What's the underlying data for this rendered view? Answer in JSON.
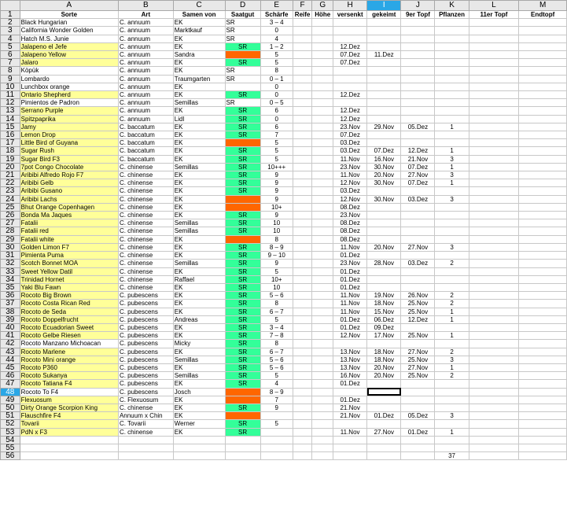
{
  "columns": [
    "A",
    "B",
    "C",
    "D",
    "E",
    "F",
    "G",
    "H",
    "I",
    "J",
    "K",
    "L",
    "M"
  ],
  "selected_column": "I",
  "selected_row": 48,
  "header_row": [
    "Sorte",
    "Art",
    "Samen von",
    "Saatgut",
    "Schärfe",
    "Reife",
    "Höhe",
    "versenkt",
    "gekeimt",
    "9er Topf",
    "Pflanzen",
    "11er Topf",
    "Endtopf"
  ],
  "rows": [
    {
      "n": 2,
      "a": "Black Hungarian",
      "b": "C. annuum",
      "c": "EK",
      "d": "SR",
      "e": "3 – 4"
    },
    {
      "n": 3,
      "a": "California Wonder Golden",
      "b": "C. annuum",
      "c": "Marktkauf",
      "d": "SR",
      "e": "0"
    },
    {
      "n": 4,
      "a": "Hatch M.S. Junie",
      "b": "C. annuum",
      "c": "EK",
      "d": "SR",
      "e": "4"
    },
    {
      "n": 5,
      "a": "Jalapeno el Jefe",
      "ay": true,
      "b": "C. annuum",
      "c": "EK",
      "d": "SR",
      "dc": "green",
      "e": "1 – 2",
      "h": "12.Dez"
    },
    {
      "n": 6,
      "a": "Jalapeno Yellow",
      "ay": true,
      "b": "C. annuum",
      "c": "Sandra",
      "dc": "orange",
      "e": "5",
      "h": "07.Dez",
      "i": "11.Dez"
    },
    {
      "n": 7,
      "a": "Jalaro",
      "ay": true,
      "b": "C. annuum",
      "c": "EK",
      "d": "SR",
      "dc": "green",
      "e": "5",
      "h": "07.Dez"
    },
    {
      "n": 8,
      "a": "Köpük",
      "b": "C. annuum",
      "c": "EK",
      "d": "SR",
      "e": "8"
    },
    {
      "n": 9,
      "a": "Lombardo",
      "b": "C. annuum",
      "c": "Traumgarten",
      "d": "SR",
      "e": "0 – 1"
    },
    {
      "n": 10,
      "a": "Lunchbox orange",
      "b": "C. annuum",
      "c": "EK",
      "e": "0"
    },
    {
      "n": 11,
      "a": "Ontario Shepherd",
      "ay": true,
      "b": "C. annuum",
      "c": "EK",
      "d": "SR",
      "dc": "green",
      "e": "0",
      "h": "12.Dez"
    },
    {
      "n": 12,
      "a": "Pimientos de Padron",
      "b": "C. annuum",
      "c": "Semillas",
      "d": "SR",
      "e": "0 – 5"
    },
    {
      "n": 13,
      "a": "Serrano Purple",
      "ay": true,
      "b": "C. annuum",
      "c": "EK",
      "d": "SR",
      "dc": "green",
      "e": "6",
      "h": "12.Dez"
    },
    {
      "n": 14,
      "a": "Spitzpaprika",
      "ay": true,
      "b": "C. annuum",
      "c": "Lidl",
      "d": "SR",
      "dc": "green",
      "e": "0",
      "h": "12.Dez"
    },
    {
      "n": 15,
      "a": "Jamy",
      "ay": true,
      "b": "C. baccatum",
      "c": "EK",
      "d": "SR",
      "dc": "green",
      "e": "6",
      "h": "23.Nov",
      "i": "29.Nov",
      "j": "05.Dez",
      "k": "1"
    },
    {
      "n": 16,
      "a": "Lemon Drop",
      "ay": true,
      "b": "C. baccatum",
      "c": "EK",
      "d": "SR",
      "dc": "green",
      "e": "7",
      "h": "07.Dez"
    },
    {
      "n": 17,
      "a": "Little Bird of Guyana",
      "ay": true,
      "b": "C. baccatum",
      "c": "EK",
      "dc": "orange",
      "e": "5",
      "h": "03.Dez"
    },
    {
      "n": 18,
      "a": "Sugar Rush",
      "ay": true,
      "b": "C. baccatum",
      "c": "EK",
      "d": "SR",
      "dc": "green",
      "e": "5",
      "h": "03.Dez",
      "i": "07.Dez",
      "j": "12.Dez",
      "k": "1"
    },
    {
      "n": 19,
      "a": "Sugar Bird F3",
      "ay": true,
      "b": "C. baccatum",
      "c": "EK",
      "d": "SR",
      "dc": "green",
      "e": "5",
      "h": "11.Nov",
      "i": "16.Nov",
      "j": "21.Nov",
      "k": "3"
    },
    {
      "n": 20,
      "a": "7pot Congo Chocolate",
      "ay": true,
      "b": "C. chinense",
      "c": "Semillas",
      "d": "SR",
      "dc": "green",
      "e": "10+++",
      "h": "23.Nov",
      "i": "30.Nov",
      "j": "07.Dez",
      "k": "1"
    },
    {
      "n": 21,
      "a": "Aribibi Alfredo Rojo F7",
      "ay": true,
      "b": "C. chinense",
      "c": "EK",
      "d": "SR",
      "dc": "green",
      "e": "9",
      "h": "11.Nov",
      "i": "20.Nov",
      "j": "27.Nov",
      "k": "3"
    },
    {
      "n": 22,
      "a": "Aribibi Gelb",
      "ay": true,
      "b": "C. chinense",
      "c": "EK",
      "d": "SR",
      "dc": "green",
      "e": "9",
      "h": "12.Nov",
      "i": "30.Nov",
      "j": "07.Dez",
      "k": "1"
    },
    {
      "n": 23,
      "a": "Aribibi Gusano",
      "ay": true,
      "b": "C. chinense",
      "c": "EK",
      "d": "SR",
      "dc": "green",
      "e": "9",
      "h": "03.Dez"
    },
    {
      "n": 24,
      "a": "Aribibi Lachs",
      "ay": true,
      "b": "C. chinense",
      "c": "EK",
      "dc": "orange",
      "e": "9",
      "h": "12.Nov",
      "i": "30.Nov",
      "j": "03.Dez",
      "k": "3"
    },
    {
      "n": 25,
      "a": "Bhut Orange Copenhagen",
      "ay": true,
      "b": "C. chinense",
      "c": "EK",
      "dc": "orange",
      "e": "10+",
      "h": "08.Dez"
    },
    {
      "n": 26,
      "a": "Bonda Ma Jaques",
      "ay": true,
      "b": "C. chinense",
      "c": "EK",
      "d": "SR",
      "dc": "green",
      "e": "9",
      "h": "23.Nov"
    },
    {
      "n": 27,
      "a": "Fatalii",
      "ay": true,
      "b": "C. chinense",
      "c": "Semillas",
      "d": "SR",
      "dc": "green",
      "e": "10",
      "h": "08.Dez"
    },
    {
      "n": 28,
      "a": "Fatalii red",
      "ay": true,
      "b": "C. chinense",
      "c": "Semillas",
      "d": "SR",
      "dc": "green",
      "e": "10",
      "h": "08.Dez"
    },
    {
      "n": 29,
      "a": "Fatalii white",
      "ay": true,
      "b": "C. chinense",
      "c": "EK",
      "dc": "orange",
      "e": "8",
      "h": "08.Dez"
    },
    {
      "n": 30,
      "a": "Golden Limon F7",
      "ay": true,
      "b": "C. chinense",
      "c": "EK",
      "d": "SR",
      "dc": "green",
      "e": "8 – 9",
      "h": "11.Nov",
      "i": "20.Nov",
      "j": "27.Nov",
      "k": "3"
    },
    {
      "n": 31,
      "a": "Pimienta Puma",
      "ay": true,
      "b": "C. chinense",
      "c": "EK",
      "d": "SR",
      "dc": "green",
      "e": "9 – 10",
      "h": "01.Dez"
    },
    {
      "n": 32,
      "a": "Scotch Bonnet MOA",
      "ay": true,
      "b": "C. chinense",
      "c": "Semillas",
      "d": "SR",
      "dc": "green",
      "e": "9",
      "h": "23.Nov",
      "i": "28.Nov",
      "j": "03.Dez",
      "k": "2"
    },
    {
      "n": 33,
      "a": "Sweet Yellow Datil",
      "ay": true,
      "b": "C. chinense",
      "c": "EK",
      "d": "SR",
      "dc": "green",
      "e": "5",
      "h": "01.Dez"
    },
    {
      "n": 34,
      "a": "Trinidad Hornet",
      "ay": true,
      "b": "C. chinense",
      "c": "Raffael",
      "d": "SR",
      "dc": "green",
      "e": "10+",
      "h": "01.Dez"
    },
    {
      "n": 35,
      "a": "Yaki Blu Fawn",
      "ay": true,
      "b": "C. chinense",
      "c": "EK",
      "d": "SR",
      "dc": "green",
      "e": "10",
      "h": "01.Dez"
    },
    {
      "n": 36,
      "a": "Rocoto Big Brown",
      "ay": true,
      "b": "C. pubescens",
      "c": "EK",
      "d": "SR",
      "dc": "green",
      "e": "5 – 6",
      "h": "11.Nov",
      "i": "19.Nov",
      "j": "26.Nov",
      "k": "2"
    },
    {
      "n": 37,
      "a": "Rocoto Costa Rican Red",
      "ay": true,
      "b": "C. pubescens",
      "c": "EK",
      "d": "SR",
      "dc": "green",
      "e": "8",
      "h": "11.Nov",
      "i": "18.Nov",
      "j": "25.Nov",
      "k": "2"
    },
    {
      "n": 38,
      "a": "Rocoto de Seda",
      "ay": true,
      "b": "C. pubescens",
      "c": "EK",
      "d": "SR",
      "dc": "green",
      "e": "6 – 7",
      "h": "11.Nov",
      "i": "15.Nov",
      "j": "25.Nov",
      "k": "1"
    },
    {
      "n": 39,
      "a": "Rocoto Doppelfrucht",
      "ay": true,
      "b": "C. pubescens",
      "c": "Andreas",
      "d": "SR",
      "dc": "green",
      "e": "5",
      "h": "01.Dez",
      "i": "06.Dez",
      "j": "12.Dez",
      "k": "1"
    },
    {
      "n": 40,
      "a": "Rocoto Ecuadorian Sweet",
      "ay": true,
      "b": "C. pubescens",
      "c": "EK",
      "d": "SR",
      "dc": "green",
      "e": "3 – 4",
      "h": "01.Dez",
      "i": "09.Dez"
    },
    {
      "n": 41,
      "a": "Rocoto Gelbe Riesen",
      "ay": true,
      "b": "C. pubescens",
      "c": "EK",
      "d": "SR",
      "dc": "green",
      "e": "7 – 8",
      "h": "12.Nov",
      "i": "17.Nov",
      "j": "25.Nov",
      "k": "1"
    },
    {
      "n": 42,
      "a": "Rocoto Manzano Michoacan",
      "b": "C. pubescens",
      "c": "Micky",
      "d": "SR",
      "dc": "green",
      "e": "8"
    },
    {
      "n": 43,
      "a": "Rocoto Marlene",
      "ay": true,
      "b": "C. pubescens",
      "c": "EK",
      "d": "SR",
      "dc": "green",
      "e": "6 – 7",
      "h": "13.Nov",
      "i": "18.Nov",
      "j": "27.Nov",
      "k": "2"
    },
    {
      "n": 44,
      "a": "Rocoto Mini orange",
      "ay": true,
      "b": "C. pubescens",
      "c": "Semillas",
      "d": "SR",
      "dc": "green",
      "e": "5 – 6",
      "h": "13.Nov",
      "i": "18.Nov",
      "j": "25.Nov",
      "k": "3"
    },
    {
      "n": 45,
      "a": "Rocoto P360",
      "ay": true,
      "b": "C. pubescens",
      "c": "EK",
      "d": "SR",
      "dc": "green",
      "e": "5 – 6",
      "h": "13.Nov",
      "i": "20.Nov",
      "j": "27.Nov",
      "k": "1"
    },
    {
      "n": 46,
      "a": "Rocoto Sukanya",
      "ay": true,
      "b": "C. pubescens",
      "c": "Semillas",
      "d": "SR",
      "dc": "green",
      "e": "5",
      "h": "16.Nov",
      "i": "20.Nov",
      "j": "25.Nov",
      "k": "2"
    },
    {
      "n": 47,
      "a": "Rocoto Tatiana F4",
      "ay": true,
      "b": "C. pubescens",
      "c": "EK",
      "d": "SR",
      "dc": "green",
      "e": "4",
      "h": "01.Dez"
    },
    {
      "n": 48,
      "a": "Rocoto To F4",
      "b": "C. pubescens",
      "c": "Josch",
      "dc": "orange",
      "e": "8 – 9",
      "active_i": true
    },
    {
      "n": 49,
      "a": "Flexuosum",
      "ay": true,
      "b": "C. Flexuosum",
      "c": "EK",
      "dc": "orange",
      "e": "7",
      "h": "01.Dez"
    },
    {
      "n": 50,
      "a": "Dirty Orange Scorpion King",
      "ay": true,
      "b": "C. chinense",
      "c": "EK",
      "d": "SR",
      "dc": "green",
      "e": "9",
      "h": "21.Nov"
    },
    {
      "n": 51,
      "a": "Flauschfire F4",
      "ay": true,
      "b": "Annuum x Chin",
      "c": "EK",
      "dc": "orange",
      "h": "21.Nov",
      "i": "01.Dez",
      "j": "05.Dez",
      "k": "3"
    },
    {
      "n": 52,
      "a": "Tovarii",
      "ay": true,
      "b": "C. Tovarii",
      "c": "Werner",
      "d": "SR",
      "dc": "green",
      "e": "5"
    },
    {
      "n": 53,
      "a": "PdN x  F3",
      "ay": true,
      "b": "C. chinense",
      "c": "EK",
      "d": "SR",
      "dc": "green",
      "h": "11.Nov",
      "i": "27.Nov",
      "j": "01.Dez",
      "k": "1"
    },
    {
      "n": 54
    },
    {
      "n": 55
    },
    {
      "n": 56,
      "k": "37"
    }
  ]
}
